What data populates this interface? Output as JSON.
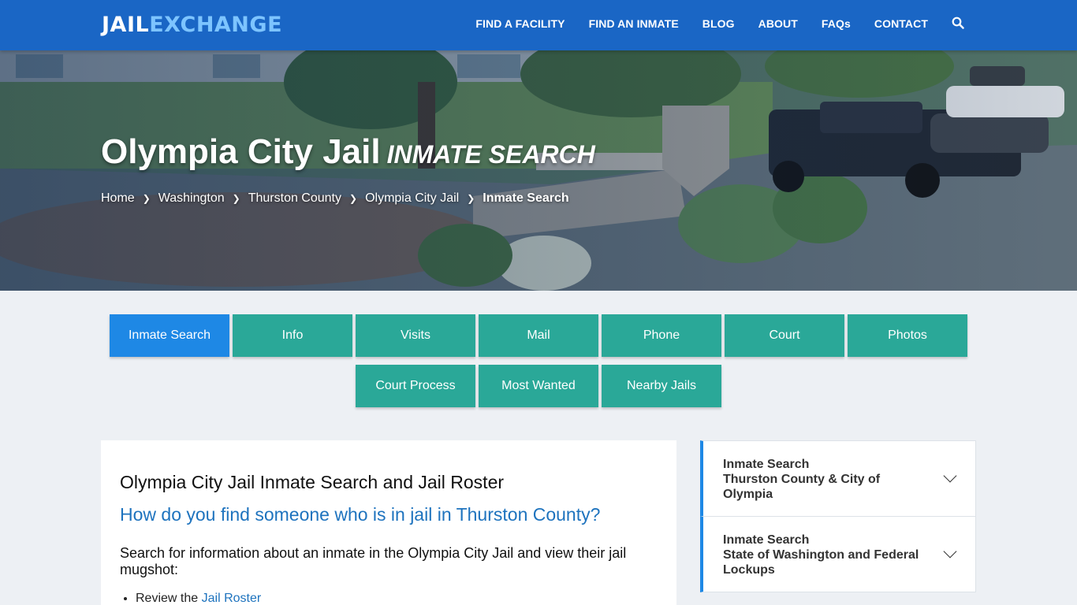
{
  "header": {
    "logo_part1": "JAIL",
    "logo_part2": "EXCHANGE",
    "nav": [
      "FIND A FACILITY",
      "FIND AN INMATE",
      "BLOG",
      "ABOUT",
      "FAQs",
      "CONTACT"
    ]
  },
  "hero": {
    "title": "Olympia City Jail",
    "subtitle": "Inmate Search",
    "breadcrumb": [
      "Home",
      "Washington",
      "Thurston County",
      "Olympia City Jail",
      "Inmate Search"
    ]
  },
  "tabs": {
    "row1": [
      "Inmate Search",
      "Info",
      "Visits",
      "Mail",
      "Phone",
      "Court",
      "Photos"
    ],
    "row2": [
      "Court Process",
      "Most Wanted",
      "Nearby Jails"
    ]
  },
  "content": {
    "heading": "Olympia City Jail Inmate Search and Jail Roster",
    "question": "How do you find someone who is in jail in Thurston County?",
    "intro": "Search for information about an inmate in the Olympia City Jail and view their jail mugshot:",
    "list_item_prefix": "Review the",
    "list_item_link": "Jail Roster"
  },
  "sidebar": [
    {
      "line1": "Inmate Search",
      "line2": "Thurston County & City of Olympia"
    },
    {
      "line1": "Inmate Search",
      "line2": "State of Washington and Federal Lockups"
    }
  ],
  "colors": {
    "header_bg": "#1a66c5",
    "tab_bg": "#2aa898",
    "tab_active": "#1e88e5",
    "link": "#1e73be"
  }
}
